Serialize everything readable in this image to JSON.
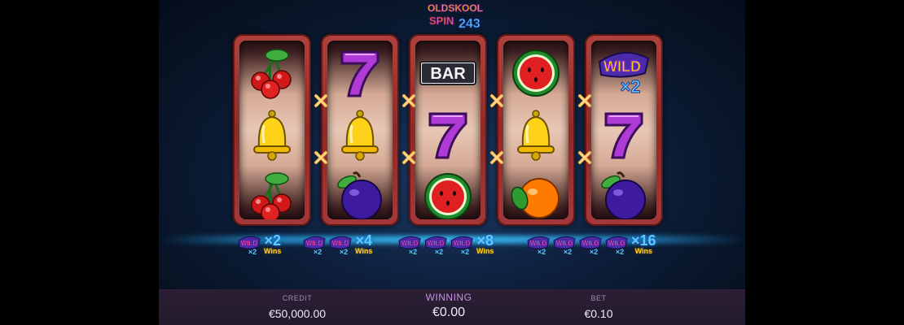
{
  "game": {
    "logo_line1": "OLDSKOOL",
    "logo_line2": "SPIN",
    "logo_line3": "243"
  },
  "reels": [
    [
      "cherry",
      "bell",
      "cherry"
    ],
    [
      "seven",
      "bell",
      "plum"
    ],
    [
      "bar",
      "seven",
      "watermelon"
    ],
    [
      "watermelon",
      "bell",
      "orange"
    ],
    [
      "wild-x2",
      "seven",
      "plum"
    ]
  ],
  "symbols": {
    "bar_label": "BAR",
    "wild_label": "WILD",
    "wild_multiplier": "×2"
  },
  "wild_paytable": [
    {
      "count": 1,
      "multiplier": "×2",
      "suffix": "Wins"
    },
    {
      "count": 2,
      "multiplier": "×4",
      "suffix": "Wins"
    },
    {
      "count": 3,
      "multiplier": "×8",
      "suffix": "Wins"
    },
    {
      "count": 4,
      "multiplier": "×16",
      "suffix": "Wins"
    }
  ],
  "stats": {
    "credit_label": "CREDIT",
    "credit_value": "€50,000.00",
    "winning_label": "WINNING",
    "winning_value": "€0.00",
    "bet_label": "BET",
    "bet_value": "€0.10"
  },
  "colors": {
    "background": "#0d1f3c",
    "reel_frame": "#a3383a",
    "multiplier_text": "#5ec8ff",
    "wins_text": "#ffd21a",
    "bottom_bar": "#2c1f35"
  }
}
